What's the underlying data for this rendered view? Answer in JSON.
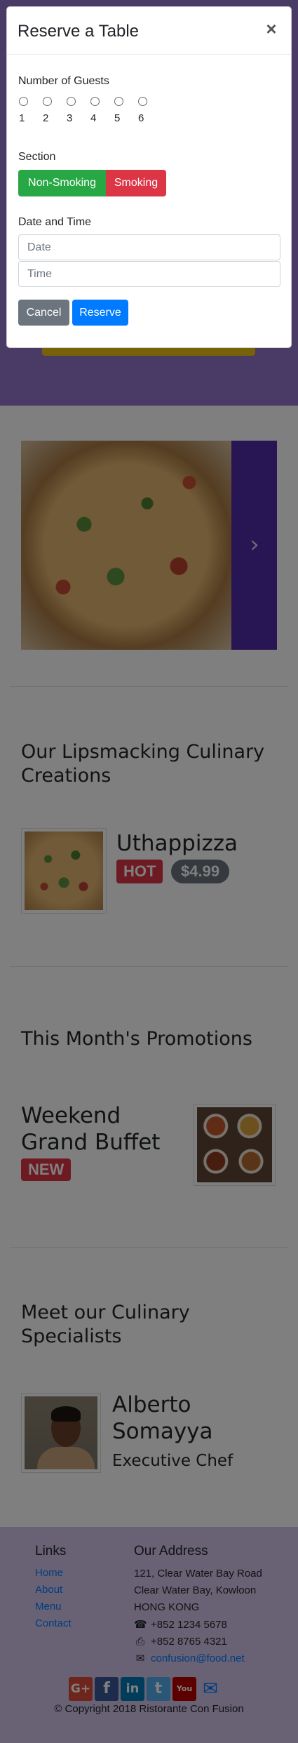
{
  "modal": {
    "title": "Reserve a Table",
    "close_label": "×",
    "guests_label": "Number of Guests",
    "guest_options": [
      "1",
      "2",
      "3",
      "4",
      "5",
      "6"
    ],
    "section_label": "Section",
    "section_options": [
      "Non-Smoking",
      "Smoking"
    ],
    "datetime_label": "Date and Time",
    "date_placeholder": "Date",
    "time_placeholder": "Time",
    "cancel_label": "Cancel",
    "reserve_label": "Reserve"
  },
  "carousel": {
    "next_icon": "chevron-right-icon",
    "next_glyph": "›"
  },
  "dishes": {
    "heading": "Our Lipsmacking Culinary Creations",
    "name": "Uthappizza",
    "badge": "HOT",
    "price": "$4.99"
  },
  "promotions": {
    "heading": "This Month's Promotions",
    "name": "Weekend Grand Buffet",
    "badge": "NEW"
  },
  "specialists": {
    "heading": "Meet our Culinary Specialists",
    "name": "Alberto Somayya",
    "designation": "Executive Chef"
  },
  "footer": {
    "links_heading": "Links",
    "links": [
      "Home",
      "About",
      "Menu",
      "Contact"
    ],
    "address_heading": "Our Address",
    "address_lines": [
      "121, Clear Water Bay Road",
      "Clear Water Bay, Kowloon",
      "HONG KONG"
    ],
    "phone": "+852 1234 5678",
    "fax": "+852 8765 4321",
    "email": "confusion@food.net",
    "social": [
      {
        "icon": "google-plus-icon",
        "glyph": "G+",
        "color": "#dd4b39"
      },
      {
        "icon": "facebook-icon",
        "glyph": "f",
        "color": "#3b5998"
      },
      {
        "icon": "linkedin-icon",
        "glyph": "in",
        "color": "#007bb6"
      },
      {
        "icon": "twitter-icon",
        "glyph": "t",
        "color": "#55acee"
      },
      {
        "icon": "youtube-icon",
        "glyph": "You",
        "color": "#bb0000"
      },
      {
        "icon": "mail-icon",
        "glyph": "✉",
        "color": "transparent"
      }
    ],
    "copyright": "© Copyright 2018 Ristorante Con Fusion"
  },
  "colors": {
    "jumbotron": "#9575cd",
    "accent": "#512da8",
    "footer": "#d1c4e9",
    "success": "#28a745",
    "danger": "#dc3545",
    "primary": "#007bff",
    "secondary": "#6c757d"
  }
}
